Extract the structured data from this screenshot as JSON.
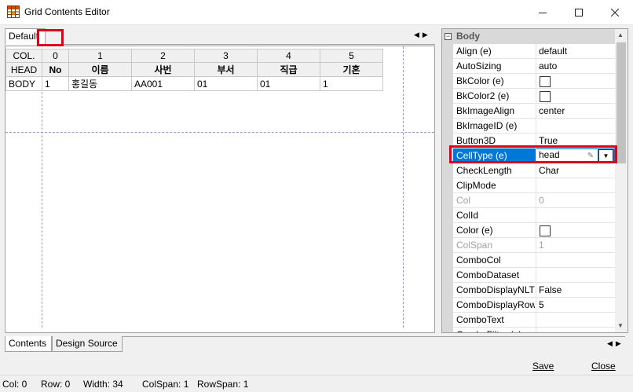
{
  "window": {
    "title": "Grid Contents Editor",
    "minimize_icon": "minimize-icon",
    "maximize_icon": "maximize-icon",
    "close_icon": "close-icon"
  },
  "top_tabs": {
    "default_label": "Default"
  },
  "grid": {
    "corner_label": "COL.",
    "col_numbers": [
      "0",
      "1",
      "2",
      "3",
      "4",
      "5"
    ],
    "head_label": "HEAD",
    "head_cells": [
      "No",
      "이름",
      "사번",
      "부서",
      "직급",
      "기혼"
    ],
    "body_label": "BODY",
    "body_cells": [
      "1",
      "홍길동",
      "AA001",
      "01",
      "01",
      "1"
    ]
  },
  "properties": {
    "section": "Body",
    "rows": [
      {
        "name": "Align (e)",
        "value": "default"
      },
      {
        "name": "AutoSizing",
        "value": "auto"
      },
      {
        "name": "BkColor (e)",
        "value": ""
      },
      {
        "name": "BkColor2 (e)",
        "value": ""
      },
      {
        "name": "BkImageAlign",
        "value": "center"
      },
      {
        "name": "BkImageID (e)",
        "value": ""
      },
      {
        "name": "Button3D",
        "value": "True"
      },
      {
        "name": "CellType (e)",
        "value": "head"
      },
      {
        "name": "CheckLength",
        "value": "Char"
      },
      {
        "name": "ClipMode",
        "value": ""
      },
      {
        "name": "Col",
        "value": "0"
      },
      {
        "name": "ColId",
        "value": ""
      },
      {
        "name": "Color (e)",
        "value": ""
      },
      {
        "name": "ColSpan",
        "value": "1"
      },
      {
        "name": "ComboCol",
        "value": ""
      },
      {
        "name": "ComboDataset",
        "value": ""
      },
      {
        "name": "ComboDisplayNLT",
        "value": "False"
      },
      {
        "name": "ComboDisplayRow",
        "value": "5"
      },
      {
        "name": "ComboText",
        "value": ""
      },
      {
        "name": "ComboFilter (e)",
        "value": ""
      }
    ]
  },
  "bottom_tabs": {
    "contents": "Contents",
    "design_source": "Design Source"
  },
  "buttons": {
    "save": "Save",
    "close": "Close"
  },
  "status": {
    "col": "Col: 0",
    "row": "Row: 0",
    "width": "Width: 34",
    "colspan": "ColSpan: 1",
    "rowspan": "RowSpan: 1"
  },
  "colors": {
    "selection": "#0078d7",
    "highlight_box": "#e0001b"
  }
}
